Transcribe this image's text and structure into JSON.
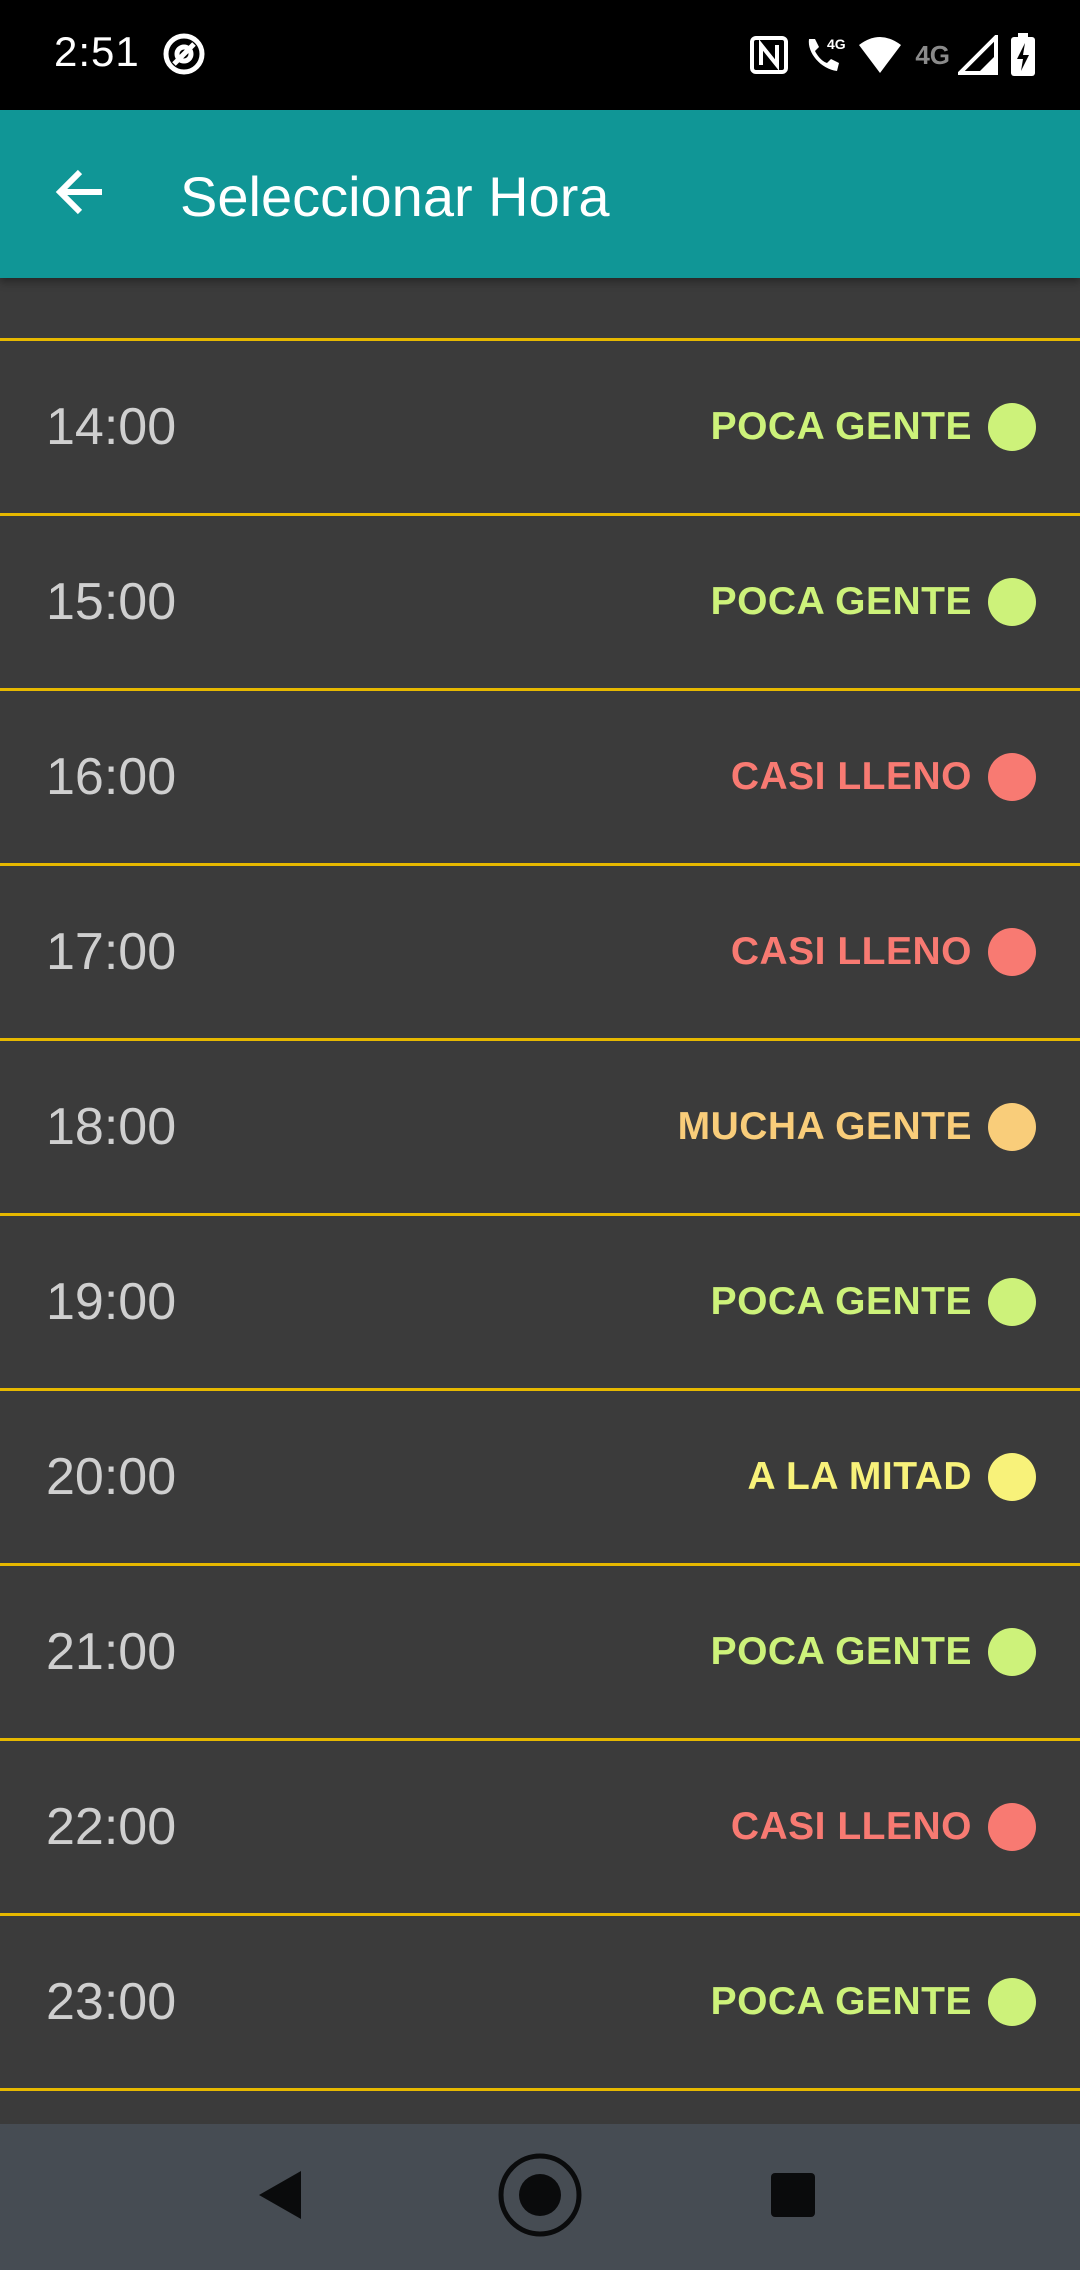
{
  "status_bar": {
    "time": "2:51",
    "network_label": "4G",
    "network_label_2": "4G",
    "icons": [
      "at-sign-icon",
      "nfc-icon",
      "wifi-call-icon",
      "wifi-icon",
      "signal-icon",
      "battery-charging-icon"
    ]
  },
  "app_bar": {
    "title": "Seleccionar Hora",
    "back_icon": "arrow-left-icon",
    "background_color": "#109696"
  },
  "status_colors": {
    "POCA GENTE": "#cdf27a",
    "CASI LLENO": "#f87a72",
    "MUCHA GENTE": "#f9cd7a",
    "A LA MITAD": "#f8f27a"
  },
  "divider_color": "#e6b800",
  "slots": [
    {
      "time": "14:00",
      "status": "POCA GENTE"
    },
    {
      "time": "15:00",
      "status": "POCA GENTE"
    },
    {
      "time": "16:00",
      "status": "CASI LLENO"
    },
    {
      "time": "17:00",
      "status": "CASI LLENO"
    },
    {
      "time": "18:00",
      "status": "MUCHA GENTE"
    },
    {
      "time": "19:00",
      "status": "POCA GENTE"
    },
    {
      "time": "20:00",
      "status": "A LA MITAD"
    },
    {
      "time": "21:00",
      "status": "POCA GENTE"
    },
    {
      "time": "22:00",
      "status": "CASI LLENO"
    },
    {
      "time": "23:00",
      "status": "POCA GENTE"
    }
  ],
  "nav_bar": {
    "buttons": [
      "back-triangle-icon",
      "home-circle-icon",
      "recents-square-icon"
    ]
  }
}
